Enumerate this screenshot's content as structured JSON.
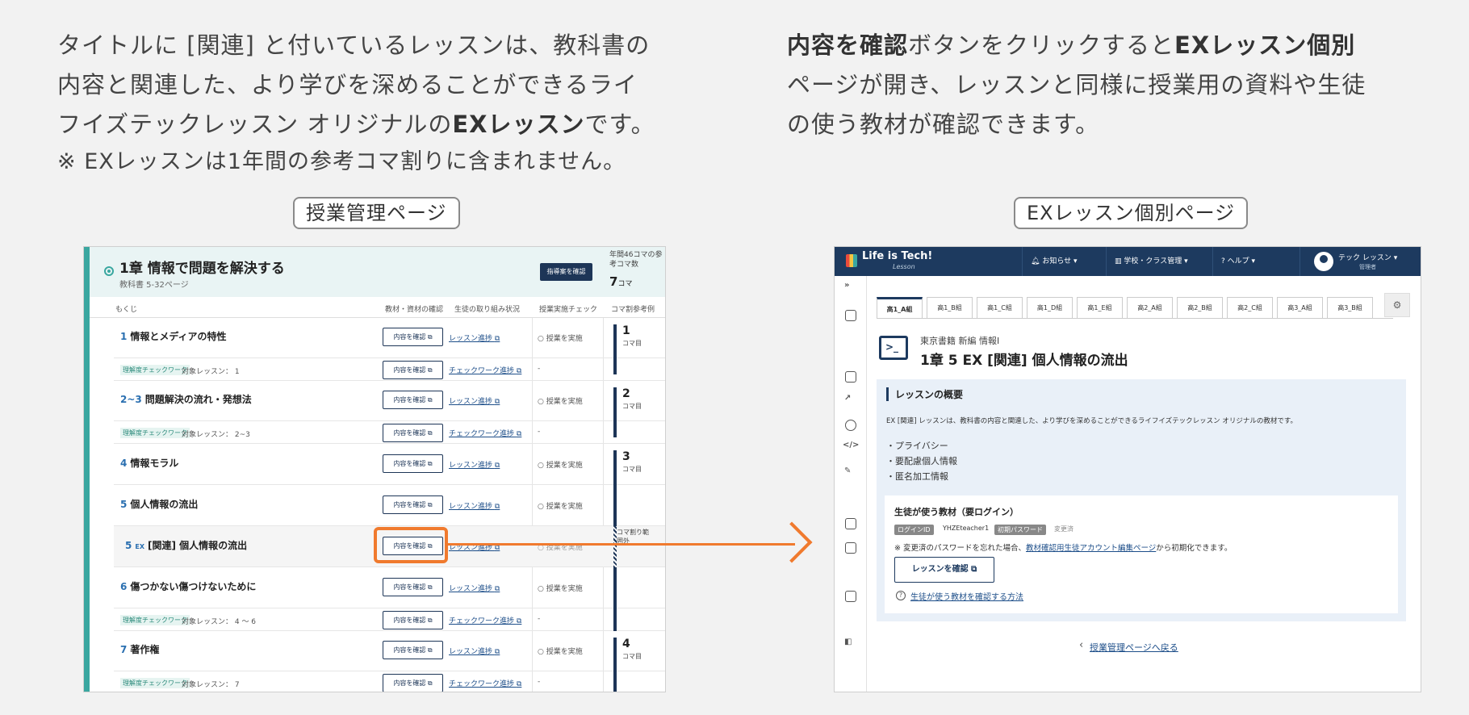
{
  "intro_left": {
    "line1": "タイトルに [関連] と付いているレッスンは、教科書の",
    "line2": "内容と関連した、より学びを深めることができるライ",
    "line3_pre": "フイズテックレッスン オリジナルの",
    "line3_bold": "EXレッスン",
    "line3_post": "です。",
    "note": "※ EXレッスンは1年間の参考コマ割りに含まれません。"
  },
  "intro_right": {
    "bold1": "内容を確認",
    "text1": "ボタンをクリックすると",
    "bold2": "EXレッスン個別",
    "line2": "ページが開き、レッスンと同様に授業用の資料や生徒",
    "line3": "の使う教材が確認できます。"
  },
  "captions": {
    "left": "授業管理ページ",
    "right": "EXレッスン個別ページ"
  },
  "colors": {
    "accent_teal": "#3aa7a0",
    "navy": "#1d3557",
    "highlight_orange": "#f07a2e"
  },
  "left_panel": {
    "chapter_title": "1章 情報で問題を解決する",
    "textbook_pages": "教科書 5-32ページ",
    "guide_button": "指導案を確認",
    "annual_label": "年間46コマの参考コマ数",
    "annual_num": "7",
    "annual_unit": "コマ",
    "columns": {
      "toc": "もくじ",
      "materials": "教材・資材の確認",
      "progress": "生徒の取り組み状況",
      "check": "授業実施チェック",
      "koma": "コマ割参考例"
    },
    "confirm_label": "内容を確認",
    "lesson_progress_label": "レッスン進捗",
    "checkwork_progress_label": "チェックワーク進捗",
    "implement_label": "○ 授業を実施",
    "checkwork_tag": "理解度チェックワーク",
    "dash": "-",
    "koma_unit": "コマ目",
    "koma_excluded": "コマ割り範囲外",
    "lessons": [
      {
        "num": "1",
        "title": "情報とメディアの特性",
        "target": "対象レッスン： 1",
        "koma": "1"
      },
      {
        "num": "2~3",
        "title": "問題解決の流れ・発想法",
        "target": "対象レッスン： 2~3",
        "koma": "2"
      },
      {
        "num": "4",
        "title": "情報モラル",
        "koma": "3"
      },
      {
        "num": "5",
        "title": "個人情報の流出"
      },
      {
        "num": "5",
        "ex": "EX",
        "title": "[関連] 個人情報の流出"
      },
      {
        "num": "6",
        "title": "傷つかない傷つけないために",
        "target": "対象レッスン： 4 ～ 6"
      },
      {
        "num": "7",
        "title": "著作権",
        "target": "対象レッスン： 7",
        "koma": "4"
      }
    ]
  },
  "right_panel": {
    "logo": "Life is Tech!",
    "logo_sub": "Lesson",
    "nav": {
      "notice": "お知らせ",
      "school": "学校・クラス管理",
      "help": "ヘルプ"
    },
    "user_name": "テック レッスン",
    "user_role": "管理者",
    "tabs": [
      "高1_A組",
      "高1_B組",
      "高1_C組",
      "高1_D組",
      "高1_E組",
      "高2_A組",
      "高2_B組",
      "高2_C組",
      "高3_A組",
      "高3_B組"
    ],
    "publisher": "東京書籍 新編 情報I",
    "lesson_title": "1章 5 EX [関連] 個人情報の流出",
    "overview_title": "レッスンの概要",
    "overview_desc": "EX [関連] レッスンは、教科書の内容と関連した、より学びを深めることができるライフイズテックレッスン オリジナルの教材です。",
    "bullets": [
      "・プライバシー",
      "・要配慮個人情報",
      "・匿名加工情報"
    ],
    "card_title": "生徒が使う教材（要ログイン）",
    "login_id_label": "ログインID",
    "login_id": "YHZEteacher1",
    "init_pw_label": "初期パスワード",
    "init_pw_value": "変更済",
    "pw_note_pre": "※ 変更済のパスワードを忘れた場合、",
    "pw_note_link": "教材確認用生徒アカウント編集ページ",
    "pw_note_post": "から初期化できます。",
    "confirm_lesson_button": "レッスンを確認",
    "help_link": "生徒が使う教材を確認する方法",
    "back_link": "授業管理ページへ戻る"
  }
}
